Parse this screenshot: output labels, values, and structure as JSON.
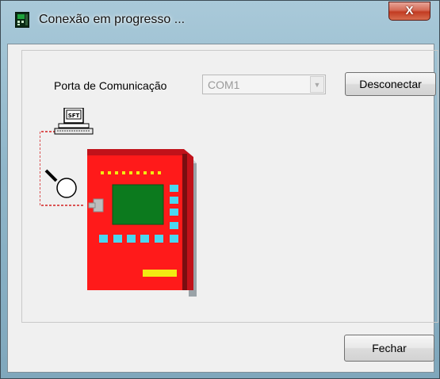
{
  "window": {
    "title": "Conexão em progresso ...",
    "close_glyph": "X"
  },
  "connection": {
    "port_label": "Porta de Comunicação",
    "port_value": "COM1",
    "disconnect_label": "Desconectar"
  },
  "illustration": {
    "computer_label": "SFT"
  },
  "footer": {
    "close_label": "Fechar"
  },
  "icons": [
    "app-icon",
    "computer-icon",
    "magnifier-icon",
    "fire-alarm-panel-icon",
    "chevron-down-icon",
    "close-icon"
  ],
  "colors": {
    "panel_red": "#ff1a1a",
    "panel_screen": "#0c7a1e",
    "panel_keys": "#4ad7f0",
    "panel_lamp": "#f2ea12",
    "link_line": "#d42020"
  }
}
